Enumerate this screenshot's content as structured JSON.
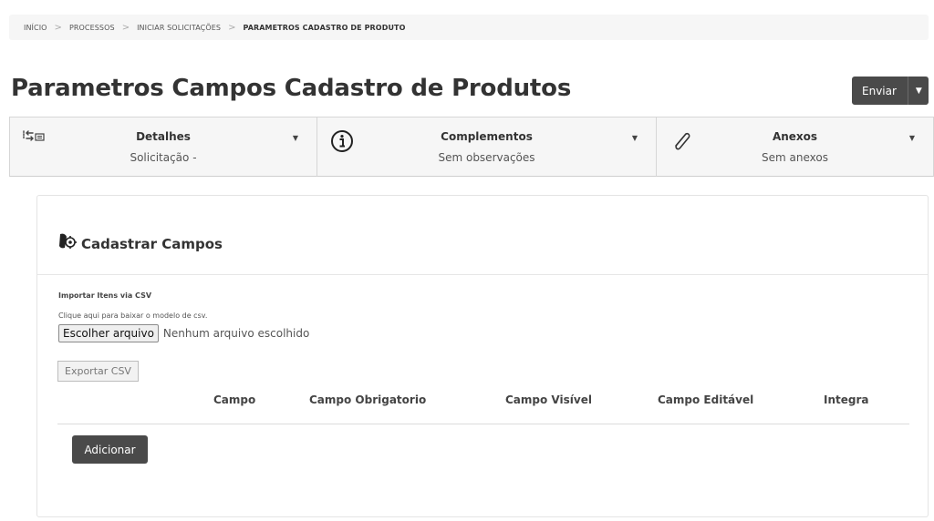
{
  "breadcrumb": {
    "items": [
      "INÍCIO",
      "PROCESSOS",
      "INICIAR SOLICITAÇÕES",
      "PARAMETROS CADASTRO DE PRODUTO"
    ],
    "separator": ">"
  },
  "page": {
    "title": "Parametros Campos Cadastro de Produtos",
    "send_label": "Enviar",
    "send_caret": "▼"
  },
  "panels": [
    {
      "icon": "transfer-list-icon",
      "title": "Detalhes",
      "subtitle": "Solicitação -"
    },
    {
      "icon": "info-circle-icon",
      "title": "Complementos",
      "subtitle": "Sem observações"
    },
    {
      "icon": "paperclip-icon",
      "title": "Anexos",
      "subtitle": "Sem anexos"
    }
  ],
  "panel_caret": "▼",
  "form": {
    "header_icon": "form-gear-icon",
    "title": "Cadastrar Campos",
    "import_title": "Importar Itens via CSV",
    "import_hint": "Clique aqui para baixar o modelo de csv.",
    "file_button": "Escolher arquivo",
    "file_status": "Nenhum arquivo escolhido",
    "export_button": "Exportar CSV",
    "columns": [
      "Campo",
      "Campo Obrigatorio",
      "Campo Visível",
      "Campo Editável",
      "Integra"
    ],
    "add_button": "Adicionar"
  },
  "colors": {
    "dark_button": "#4a4a4a",
    "panel_bg": "#f6f6f6",
    "breadcrumb_bg": "#f6f6f6"
  }
}
